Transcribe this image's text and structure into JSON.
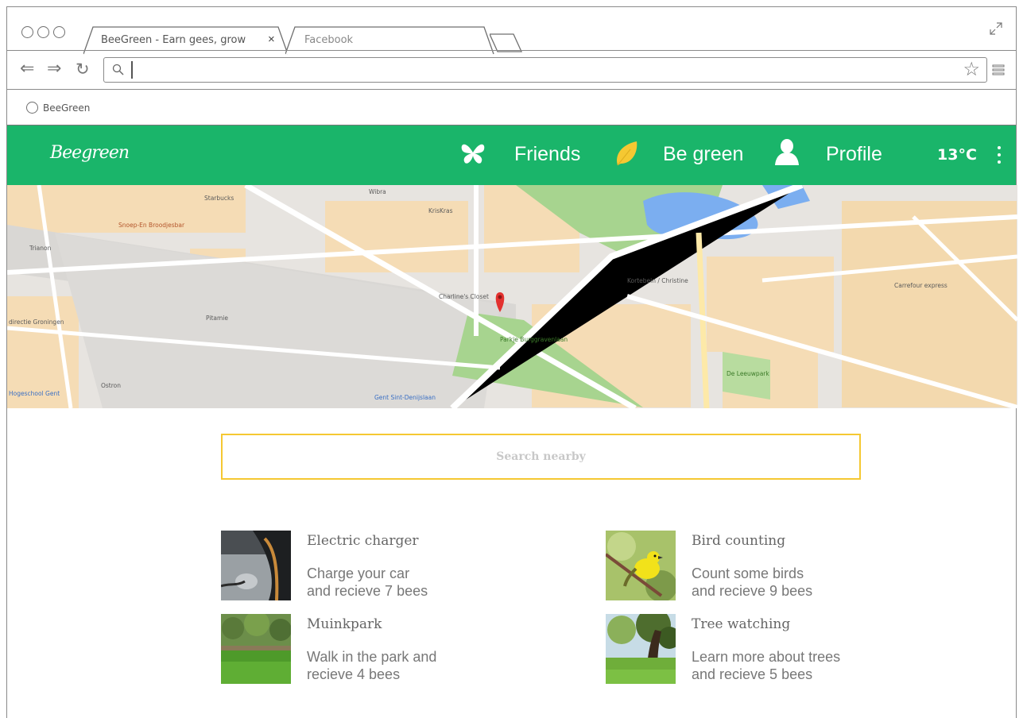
{
  "browser": {
    "tabs": [
      {
        "label": "BeeGreen - Earn gees, grow",
        "close": "×"
      },
      {
        "label": "Facebook"
      }
    ],
    "url": "",
    "bookmark": "BeeGreen"
  },
  "header": {
    "logo": "Beegreen",
    "nav": [
      {
        "label": "Friends",
        "icon": "butterfly-icon"
      },
      {
        "label": "Be green",
        "icon": "leaf-icon"
      },
      {
        "label": "Profile",
        "icon": "user-icon"
      }
    ],
    "temperature": "13°C"
  },
  "map": {
    "labels": [
      "Starbucks",
      "Wibra",
      "KrisKras",
      "Snoep-En Broodjesbar",
      "Trianon",
      "Charline's Closet",
      "Kortebein / Christine",
      "Carrefour express",
      "Pitamie",
      "Parkje Burggravenlaan",
      "De Leeuwpark",
      "Ostron",
      "directie Groningen",
      "Gent Sint-Denijslaan",
      "Hogeschool Gent"
    ]
  },
  "search": {
    "placeholder": "Search nearby"
  },
  "activities": [
    {
      "title": "Electric charger",
      "line1": "Charge your car",
      "line2": "and recieve 7 bees"
    },
    {
      "title": "Bird counting",
      "line1": "Count some birds",
      "line2": "and recieve 9 bees"
    },
    {
      "title": "Muinkpark",
      "line1": "Walk in the park and",
      "line2": "recieve 4 bees"
    },
    {
      "title": "Tree watching",
      "line1": "Learn more about trees",
      "line2": "and recieve 5 bees"
    }
  ],
  "colors": {
    "brand": "#1ab56a",
    "accent": "#f5c832",
    "leaf": "#f5c832"
  }
}
